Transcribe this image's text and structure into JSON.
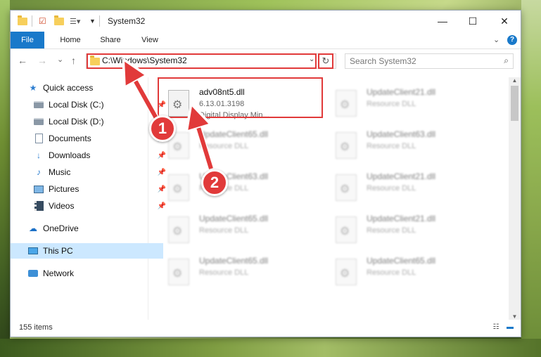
{
  "window": {
    "title": "System32",
    "minimize": "—",
    "maximize": "☐",
    "close": "✕"
  },
  "ribbon": {
    "tabs": [
      "File",
      "Home",
      "Share",
      "View"
    ],
    "collapse": "⌄",
    "help": "?"
  },
  "nav": {
    "back": "←",
    "forward": "→",
    "recent": "⌄",
    "up": "↑",
    "address": "C:\\Windows\\System32",
    "address_dropdown": "⌄",
    "refresh": "↻",
    "search_placeholder": "Search System32",
    "search_icon": "⌕"
  },
  "sidebar": {
    "items": [
      {
        "label": "Quick access",
        "icon": "star-icon"
      },
      {
        "label": "Local Disk (C:)",
        "icon": "drive-icon",
        "pinned": true
      },
      {
        "label": "Local Disk (D:)",
        "icon": "drive-icon",
        "pinned": true
      },
      {
        "label": "Documents",
        "icon": "document-icon",
        "pinned": true
      },
      {
        "label": "Downloads",
        "icon": "download-icon",
        "pinned": true
      },
      {
        "label": "Music",
        "icon": "music-icon",
        "pinned": true
      },
      {
        "label": "Pictures",
        "icon": "pictures-icon",
        "pinned": true
      },
      {
        "label": "Videos",
        "icon": "videos-icon",
        "pinned": true
      },
      {
        "label": "OneDrive",
        "icon": "cloud-icon"
      },
      {
        "label": "This PC",
        "icon": "computer-icon",
        "selected": true
      },
      {
        "label": "Network",
        "icon": "network-icon"
      }
    ],
    "pin_glyph": "📌"
  },
  "files": [
    {
      "name": "adv08nt5.dll",
      "line2": "6.13.01.3198",
      "line3": "Digital Display Min...",
      "highlighted": true
    },
    {
      "name": "UpdateClient21.dll",
      "line2": "Resource DLL"
    },
    {
      "name": "UpdateClient65.dll",
      "line2": "Resource DLL"
    },
    {
      "name": "UpdateClient63.dll",
      "line2": "Resource DLL"
    },
    {
      "name": "UpdateClient63.dll",
      "line2": "Resource DLL"
    },
    {
      "name": "UpdateClient21.dll",
      "line2": "Resource DLL"
    },
    {
      "name": "UpdateClient65.dll",
      "line2": "Resource DLL"
    },
    {
      "name": "UpdateClient21.dll",
      "line2": "Resource DLL"
    },
    {
      "name": "UpdateClient65.dll",
      "line2": "Resource DLL"
    },
    {
      "name": "UpdateClient65.dll",
      "line2": "Resource DLL"
    }
  ],
  "status": {
    "item_count": "155 items"
  },
  "annotations": {
    "step1": "1",
    "step2": "2"
  },
  "colors": {
    "accent": "#1979ca",
    "highlight": "#e13a3a",
    "selected": "#cce8ff"
  }
}
